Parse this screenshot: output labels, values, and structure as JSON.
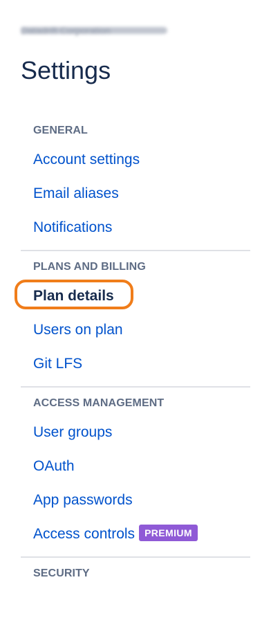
{
  "header": {
    "workspace_name": "Datadrift Corporation",
    "page_title": "Settings"
  },
  "sections": {
    "general": {
      "title": "GENERAL",
      "items": [
        "Account settings",
        "Email aliases",
        "Notifications"
      ]
    },
    "plans_billing": {
      "title": "PLANS AND BILLING",
      "items": [
        "Plan details",
        "Users on plan",
        "Git LFS"
      ]
    },
    "access_management": {
      "title": "ACCESS MANAGEMENT",
      "items": [
        "User groups",
        "OAuth",
        "App passwords",
        "Access controls"
      ],
      "badge": "PREMIUM"
    },
    "security": {
      "title": "SECURITY"
    }
  },
  "colors": {
    "link": "#0052cc",
    "active_text": "#172b4d",
    "section_header": "#5e6c84",
    "highlight_ring": "#f07d1a",
    "premium_badge": "#8f5ad6",
    "divider": "#dfe1e6"
  }
}
